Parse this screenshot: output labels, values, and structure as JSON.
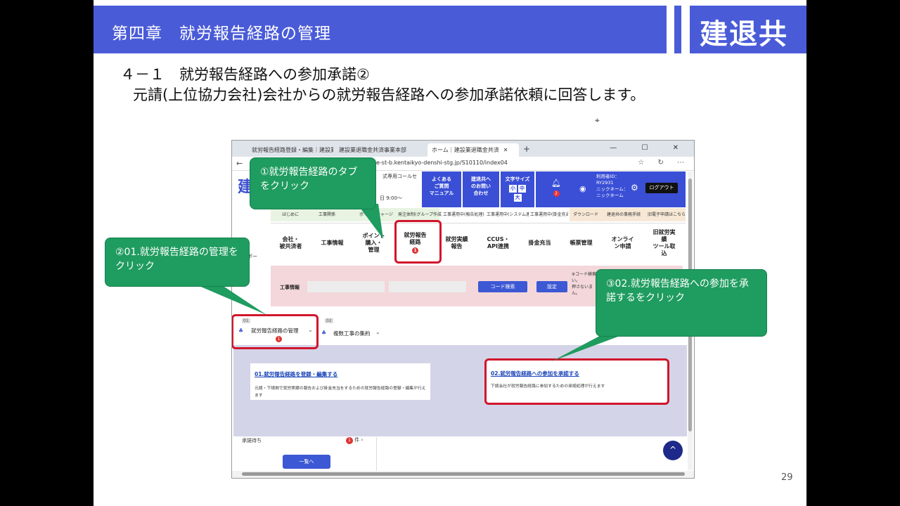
{
  "slide": {
    "header_title": "第四章　就労報告経路の管理",
    "logo_text": "建退共",
    "section_title": "４－１　就労報告経路への参加承諾②",
    "section_subtitle": "元請(上位協力会社)会社からの就労報告経路への参加承諾依頼に回答します。",
    "page_number": "29"
  },
  "browser": {
    "tabs": [
      {
        "label": "就労報告経路登録・編集｜建設業...",
        "active": false
      },
      {
        "label": "建設業退職金共済事業本部",
        "active": false
      },
      {
        "label": "ホーム｜建設業退職金共済",
        "active": true
      }
    ],
    "new_tab": "+",
    "window_controls": "— ☐ ✕",
    "back": "←",
    "url": "e-st-b.kentaikyo-denshi-stg.jp/S10110/index04"
  },
  "site": {
    "logo_fragment": "建",
    "info_line1": "式専用コールセ",
    "info_line2": "日 9:00～",
    "nav": {
      "faq": "よくある\nご質問\nマニュアル",
      "contact": "建退共へ\nのお問い\n合わせ",
      "font_size_label": "文字サイズ",
      "font_small": "小",
      "font_medium": "中",
      "font_large": "大"
    },
    "notification_count": "2",
    "user": {
      "label": "利用者ID：",
      "id": "RY2931",
      "name": "ニックネーム：ニックネーム"
    },
    "logout": "ログアウト",
    "subnav": [
      "はじめに",
      "工事関係",
      "ポイントチャージ",
      "発注体制(グループ作成)",
      "工事運用中(報告処理)",
      "工事運用中(システム連携)",
      "工事運用中(掛金充当)",
      "ダウンロード",
      "建退共の事務手続",
      "旧電子申請はこちら"
    ],
    "menu": [
      {
        "label": "会社・\n被共済者"
      },
      {
        "label": "工事情報"
      },
      {
        "label": "ポイント\n購入・\n管理"
      },
      {
        "label": "就労報告\n経路",
        "badge": "1"
      },
      {
        "label": "就労実績\n報告"
      },
      {
        "label": "CCUS・\nAPI連携"
      },
      {
        "label": "掛金充当"
      },
      {
        "label": "帳票管理"
      },
      {
        "label": "オンライ\nン申請"
      },
      {
        "label": "旧就労実\n績\nツール取\n込"
      }
    ],
    "left_fragment": "ポー",
    "filter": {
      "label": "工事情報",
      "code_search": "コード検索",
      "set": "設定",
      "note": "※コード検索\nい。\n押さないま\nん。"
    },
    "subtabs": [
      {
        "num": "01",
        "label": "就労報告経路の管理",
        "badge": "1"
      },
      {
        "num": "02",
        "label": "複数工事の集約"
      }
    ],
    "cards": [
      {
        "title": "01.就労報告経路を登録・編集する",
        "desc": "元請・下請側で就労実績の報告および掛金充当をするための就労報告経路の登録・編集が行えます"
      },
      {
        "title": "02.就労報告経路への参加を承諾する",
        "desc": "下請会社が就労報告経路に参加するための承諾処理が行えます"
      }
    ],
    "pending_label": "承諾待ち",
    "pending_count": "1",
    "pending_unit": "件",
    "list_button": "一覧へ",
    "scroll_top": "^"
  },
  "callouts": [
    {
      "text": "①就労報告経路のタブをクリック"
    },
    {
      "text": "②01.就労報告経路の管理をクリック"
    },
    {
      "text": "③02.就労報告経路への参加を承諾するをクリック"
    }
  ],
  "colors": {
    "header_blue": "#4a5bd8",
    "callout_green": "#1f9c5f",
    "highlight_red": "#d0162c"
  }
}
